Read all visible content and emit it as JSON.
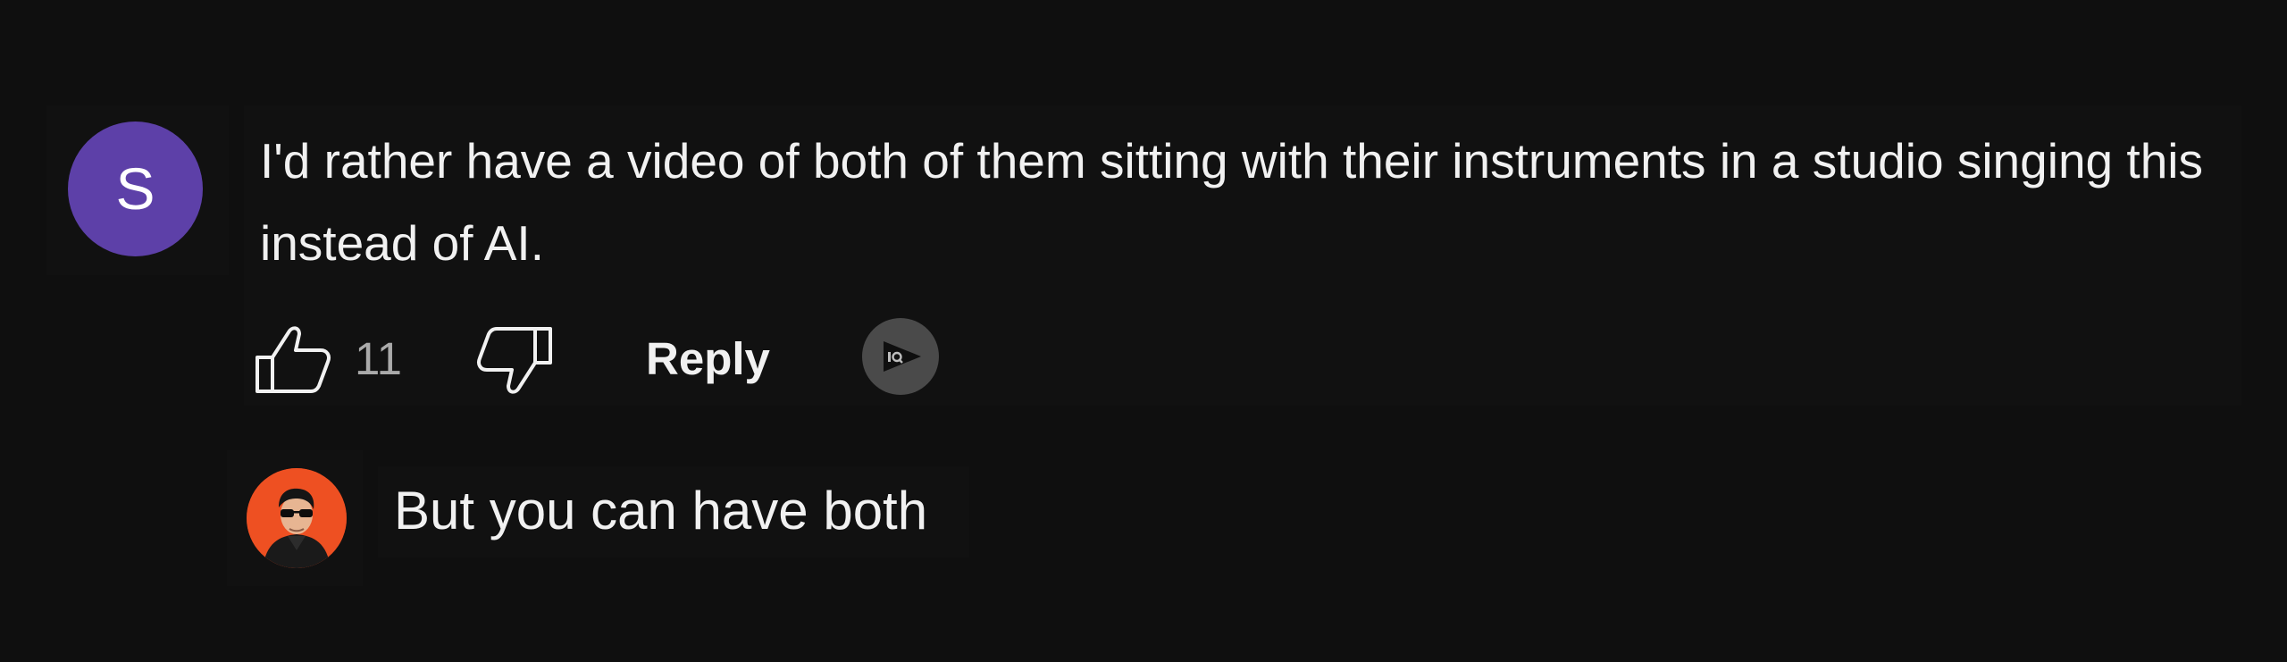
{
  "comment": {
    "avatar_letter": "S",
    "avatar_color": "#5d40a8",
    "text": "I'd rather have a video of both of them sitting with their instruments in a studio singing this instead of AI.",
    "actions": {
      "like_icon": "thumbs-up-icon",
      "like_count": "11",
      "dislike_icon": "thumbs-down-icon",
      "reply_label": "Reply",
      "extra_icon": "iq-icon"
    }
  },
  "reply": {
    "avatar_icon": "user-photo-avatar",
    "text": "But you can have both"
  }
}
